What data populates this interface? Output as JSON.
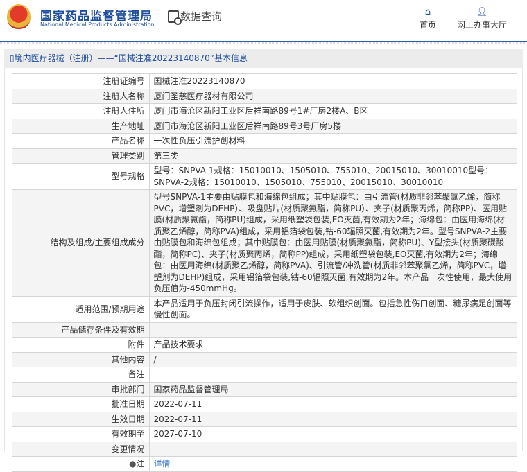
{
  "header": {
    "logo_cn": "国家药品监督管理局",
    "logo_en": "National Medical Products Administration",
    "query_label": "数据查询",
    "nav": [
      {
        "label": "首页",
        "icon": "home-icon"
      },
      {
        "label": "网上办事大厅",
        "icon": "user-icon"
      }
    ]
  },
  "title": "境内医疗器械（注册）——“国械注准20223140870”基本信息",
  "rows": [
    {
      "label": "注册证编号",
      "value": "国械注准20223140870"
    },
    {
      "label": "注册人名称",
      "value": "厦门圣慈医疗器材有限公司"
    },
    {
      "label": "注册人住所",
      "value": "厦门市海沧区新阳工业区后祥南路89号1#厂房2楼A、B区"
    },
    {
      "label": "生产地址",
      "value": "厦门市海沧区新阳工业区后祥南路89号3号厂房5楼"
    },
    {
      "label": "产品名称",
      "value": "一次性负压引流护创材料"
    },
    {
      "label": "管理类别",
      "value": "第三类"
    },
    {
      "label": "型号规格",
      "value": "型号：SNPVA-1规格：15010010、1505010、755010、20015010、30010010型号：SNPVA-2规格：15010010、1505010、755010、20015010、30010010"
    },
    {
      "label": "结构及组成/主要组成成分",
      "value": "型号SNPVA-1主要由贴膜包和海绵包组成；其中贴膜包：由引流管(材质非邻苯聚氯乙烯，简称PVC，增塑剂为DEHP）、吸盘贴片(材质聚氨酯，简称PU）、夹子(材质聚丙烯，简称PP)、医用贴膜(材质聚氨酯，简称PU)组成，采用纸塑袋包装,EO灭菌,有效期为2年；海绵包：由医用海绵(材质聚乙烯醇，简称PVA)组成，采用铝箔袋包装,钴-60辐照灭菌,有效期为2年。型号SNPVA-2主要由贴膜包和海绵包组成；其中贴膜包：由医用贴膜(材质聚氨酯，简称PU)、Y型接头(材质聚碳酸酯，简称PC)、夹子(材质聚丙烯，简称PP)组成，采用纸塑袋包装,EO灭菌,有效期为2年；海绵包：由医用海绵(材质聚乙烯醇，简称PVA)、引流管/冲洗管(材质非邻苯聚氯乙烯，简称PVC，增塑剂为DEHP)组成，采用铝箔袋包装,钴-60辐照灭菌,有效期为2年。本产品一次性使用，最大使用负压值为-450mmHg。"
    },
    {
      "label": "适用范围/预期用途",
      "value": "本产品适用于负压封闭引流操作，适用于皮肤、软组织创面。包括急性伤口创面、糖尿病足创面等慢性创面。"
    },
    {
      "label": "产品储存条件及有效期",
      "value": ""
    },
    {
      "label": "附件",
      "value": "产品技术要求"
    },
    {
      "label": "其他内容",
      "value": "/"
    },
    {
      "label": "备注",
      "value": ""
    },
    {
      "label": "审批部门",
      "value": "国家药品监督管理局"
    },
    {
      "label": "批准日期",
      "value": "2022-07-11"
    },
    {
      "label": "生效日期",
      "value": "2022-07-11"
    },
    {
      "label": "有效期至",
      "value": "2027-07-10"
    },
    {
      "label": "变更情况",
      "value": ""
    }
  ],
  "note": {
    "label": "注",
    "link": "详情"
  }
}
